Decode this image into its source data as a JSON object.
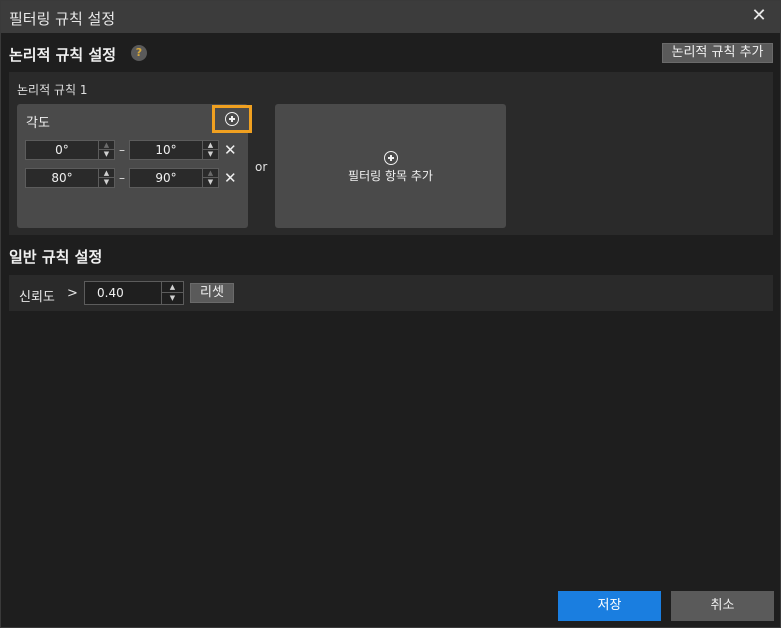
{
  "window": {
    "title": "필터링 규칙 설정"
  },
  "logical": {
    "heading": "논리적 규칙 설정",
    "help": "?",
    "add_button": "논리적 규칙 추가",
    "rule": {
      "label": "논리적 규칙 1",
      "card_title": "각도",
      "ranges": [
        {
          "from": "0°",
          "to": "10°"
        },
        {
          "from": "80°",
          "to": "90°"
        }
      ],
      "dash": "–",
      "remove": "✕"
    },
    "or": "or",
    "add_item_label": "필터링 항목 추가"
  },
  "general": {
    "heading": "일반 규칙 설정",
    "confidence_label": "신뢰도",
    "operator": ">",
    "confidence_value": "0.40",
    "reset": "리셋"
  },
  "footer": {
    "save": "저장",
    "cancel": "취소"
  }
}
